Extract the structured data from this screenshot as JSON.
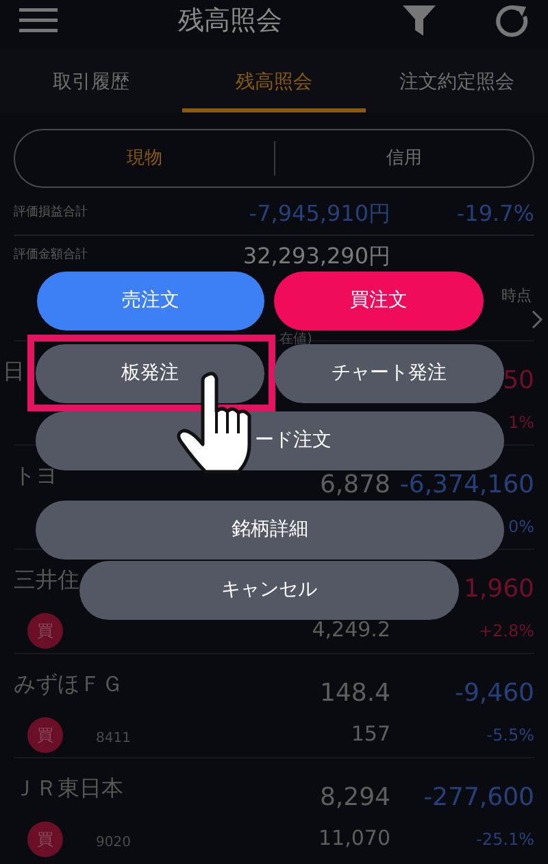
{
  "header": {
    "title": "残高照会"
  },
  "tabs": [
    {
      "label": "取引履歴",
      "selected": false
    },
    {
      "label": "残高照会",
      "selected": true
    },
    {
      "label": "注文約定照会",
      "selected": false
    }
  ],
  "segments": [
    {
      "label": "現物",
      "selected": true
    },
    {
      "label": "信用",
      "selected": false
    }
  ],
  "summary": [
    {
      "label": "評価損益合計",
      "value": "-7,945,910円",
      "percent": "-19.7%",
      "color": "#26407a"
    },
    {
      "label": "評価金額合計",
      "value": "32,293,290円",
      "color": "#7a7a7a"
    }
  ],
  "list_header": {
    "column_2": "在値)",
    "column_3": "時点"
  },
  "holdings": [
    {
      "name": "日",
      "profit": "50",
      "percent": "1%",
      "color": "#6e1028"
    },
    {
      "name": "トヨ",
      "price": "6,878",
      "profit": "-6,374,160",
      "percent": "0%",
      "color": "#26407a"
    },
    {
      "name": "三井住",
      "profit": "1,960",
      "badge": "買",
      "quantity": "4,249.2",
      "percent": "+2.8%",
      "color": "#6e1028"
    },
    {
      "name": "みずほＦＧ",
      "price": "148.4",
      "profit": "-9,460",
      "badge": "買",
      "code": "8411",
      "quantity": "157",
      "percent": "-5.5%",
      "color": "#26407a"
    },
    {
      "name": "ＪＲ東日本",
      "price": "8,294",
      "profit": "-277,600",
      "badge": "買",
      "code": "9020",
      "quantity": "11,070",
      "percent": "-25.1%",
      "color": "#26407a"
    }
  ],
  "action_menu": [
    {
      "label": "売注文",
      "kind": "sell",
      "highlighted": false
    },
    {
      "label": "買注文",
      "kind": "buy",
      "highlighted": false
    },
    {
      "label": "板発注",
      "kind": "neutral",
      "highlighted": true
    },
    {
      "label": "チャート発注",
      "kind": "neutral",
      "highlighted": false
    },
    {
      "label": "ード注文",
      "kind": "neutral",
      "highlighted": false
    },
    {
      "label": "銘柄詳細",
      "kind": "neutral",
      "highlighted": false
    },
    {
      "label": "キャンセル",
      "kind": "neutral",
      "highlighted": false
    }
  ]
}
